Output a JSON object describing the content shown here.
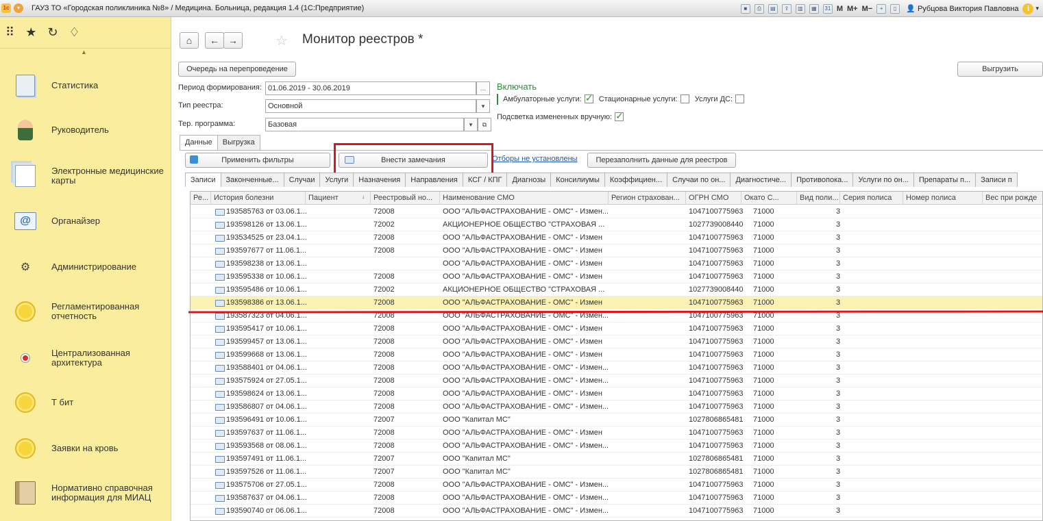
{
  "titlebar": {
    "title": "ГАУЗ ТО «Городская поликлиника №8» / Медицина. Больница, редакция 1.4  (1С:Предприятие)",
    "m_labels": [
      "M",
      "M+",
      "M−"
    ],
    "user": "Рубцова Виктория Павловна"
  },
  "sidebar": {
    "items": [
      {
        "label": "Статистика",
        "icon": "statistics-doc-icon"
      },
      {
        "label": "Руководитель",
        "icon": "manager-person-icon"
      },
      {
        "label": "Электронные медицинские карты",
        "icon": "medical-cards-icon"
      },
      {
        "label": "Органайзер",
        "icon": "organizer-mail-icon"
      },
      {
        "label": "Администрирование",
        "icon": "gear-icon"
      },
      {
        "label": "Регламентированная отчетность",
        "icon": "yellow-circle-icon"
      },
      {
        "label": "Централизованная архитектура",
        "icon": "red-ball-icon"
      },
      {
        "label": "Т бит",
        "icon": "yellow-circle-icon"
      },
      {
        "label": "Заявки на кровь",
        "icon": "yellow-circle-icon"
      },
      {
        "label": "Нормативно справочная информация для МИАЦ",
        "icon": "reference-book-icon"
      }
    ]
  },
  "page": {
    "title": "Монитор реестров *",
    "requeue_button": "Очередь на перепроведение",
    "export_button": "Выгрузить"
  },
  "form": {
    "period_label": "Период формирования:",
    "period_value": "01.06.2019 - 30.06.2019",
    "type_label": "Тип реестра:",
    "type_value": "Основной",
    "program_label": "Тер. программа:",
    "program_value": "Базовая",
    "include_title": "Включать",
    "ambulatory_label": "Амбулаторные услуги:",
    "ambulatory_checked": true,
    "inpatient_label": "Стационарные услуги:",
    "inpatient_checked": false,
    "ds_label": "Услуги ДС:",
    "ds_checked": false,
    "highlight_label": "Подсветка измененных вручную:",
    "highlight_checked": true
  },
  "tabs": [
    "Данные",
    "Выгрузка"
  ],
  "toolbar": {
    "apply_filters": "Применить фильтры",
    "add_remarks": "Внести замечания",
    "filters_link": "Отборы не установлены",
    "refill": "Перезаполнить данные для реестров"
  },
  "subtabs": [
    "Записи",
    "Законченные...",
    "Случаи",
    "Услуги",
    "Назначения",
    "Направления",
    "КСГ / КПГ",
    "Диагнозы",
    "Консилиумы",
    "Коэффициен...",
    "Случаи по он...",
    "Диагностиче...",
    "Противопока...",
    "Услуги по он...",
    "Препараты п...",
    "Записи п"
  ],
  "table": {
    "columns": [
      "Ре...",
      "История болезни",
      "Пациент",
      "Реестровый но...",
      "Наименование СМО",
      "Регион страхован...",
      "ОГРН СМО",
      "Окато С...",
      "Вид поли...",
      "Серия полиса",
      "Номер полиса",
      "Вес при рожде"
    ],
    "rows": [
      [
        "193585763 от 03.06.1...",
        "72008",
        "ООО \"АЛЬФАСТРАХОВАНИЕ - ОМС\" - Измен...",
        "1047100775963",
        "71000",
        "3"
      ],
      [
        "193598126 от 13.06.1...",
        "72002",
        "АКЦИОНЕРНОЕ ОБЩЕСТВО \"СТРАХОВАЯ ...",
        "1027739008440",
        "71000",
        "3"
      ],
      [
        "193534525 от 23.04.1...",
        "72008",
        "ООО \"АЛЬФАСТРАХОВАНИЕ - ОМС\" - Измен",
        "1047100775963",
        "71000",
        "3"
      ],
      [
        "193597677 от 11.06.1...",
        "72008",
        "ООО \"АЛЬФАСТРАХОВАНИЕ - ОМС\" - Измен",
        "1047100775963",
        "71000",
        "3"
      ],
      [
        "193598238 от 13.06.1...",
        "",
        "ООО \"АЛЬФАСТРАХОВАНИЕ - ОМС\" - Измен",
        "1047100775963",
        "71000",
        "3"
      ],
      [
        "193595338 от 10.06.1...",
        "72008",
        "ООО \"АЛЬФАСТРАХОВАНИЕ - ОМС\" - Измен",
        "1047100775963",
        "71000",
        "3"
      ],
      [
        "193595486 от 10.06.1...",
        "72002",
        "АКЦИОНЕРНОЕ ОБЩЕСТВО \"СТРАХОВАЯ ...",
        "1027739008440",
        "71000",
        "3"
      ],
      [
        "193598386 от 13.06.1...",
        "72008",
        "ООО \"АЛЬФАСТРАХОВАНИЕ - ОМС\" - Измен",
        "1047100775963",
        "71000",
        "3"
      ],
      [
        "193587323 от 04.06.1...",
        "72008",
        "ООО \"АЛЬФАСТРАХОВАНИЕ - ОМС\" - Измен...",
        "1047100775963",
        "71000",
        "3"
      ],
      [
        "193595417 от 10.06.1...",
        "72008",
        "ООО \"АЛЬФАСТРАХОВАНИЕ - ОМС\" - Измен",
        "1047100775963",
        "71000",
        "3"
      ],
      [
        "193599457 от 13.06.1...",
        "72008",
        "ООО \"АЛЬФАСТРАХОВАНИЕ - ОМС\" - Измен",
        "1047100775963",
        "71000",
        "3"
      ],
      [
        "193599668 от 13.06.1...",
        "72008",
        "ООО \"АЛЬФАСТРАХОВАНИЕ - ОМС\" - Измен",
        "1047100775963",
        "71000",
        "3"
      ],
      [
        "193588401 от 04.06.1...",
        "72008",
        "ООО \"АЛЬФАСТРАХОВАНИЕ - ОМС\" - Измен...",
        "1047100775963",
        "71000",
        "3"
      ],
      [
        "193575924 от 27.05.1...",
        "72008",
        "ООО \"АЛЬФАСТРАХОВАНИЕ - ОМС\" - Измен...",
        "1047100775963",
        "71000",
        "3"
      ],
      [
        "193598624 от 13.06.1...",
        "72008",
        "ООО \"АЛЬФАСТРАХОВАНИЕ - ОМС\" - Измен",
        "1047100775963",
        "71000",
        "3"
      ],
      [
        "193586807 от 04.06.1...",
        "72008",
        "ООО \"АЛЬФАСТРАХОВАНИЕ - ОМС\" - Измен...",
        "1047100775963",
        "71000",
        "3"
      ],
      [
        "193596491 от 10.06.1...",
        "72007",
        "ООО \"Капитал МС\"",
        "1027806865481",
        "71000",
        "3"
      ],
      [
        "193597637 от 11.06.1...",
        "72008",
        "ООО \"АЛЬФАСТРАХОВАНИЕ - ОМС\" - Измен",
        "1047100775963",
        "71000",
        "3"
      ],
      [
        "193593568 от 08.06.1...",
        "72008",
        "ООО \"АЛЬФАСТРАХОВАНИЕ - ОМС\" - Измен...",
        "1047100775963",
        "71000",
        "3"
      ],
      [
        "193597491 от 11.06.1...",
        "72007",
        "ООО \"Капитал МС\"",
        "1027806865481",
        "71000",
        "3"
      ],
      [
        "193597526 от 11.06.1...",
        "72007",
        "ООО \"Капитал МС\"",
        "1027806865481",
        "71000",
        "3"
      ],
      [
        "193575706 от 27.05.1...",
        "72008",
        "ООО \"АЛЬФАСТРАХОВАНИЕ - ОМС\" - Измен...",
        "1047100775963",
        "71000",
        "3"
      ],
      [
        "193587637 от 04.06.1...",
        "72008",
        "ООО \"АЛЬФАСТРАХОВАНИЕ - ОМС\" - Измен...",
        "1047100775963",
        "71000",
        "3"
      ],
      [
        "193590740 от 06.06.1...",
        "72008",
        "ООО \"АЛЬФАСТРАХОВАНИЕ - ОМС\" - Измен...",
        "1047100775963",
        "71000",
        "3"
      ]
    ],
    "selected_row": 7
  },
  "colors": {
    "sidebar_bg": "#fbed9e",
    "selected_row": "#fbf1b2",
    "annotation_red": "#e0141d",
    "group_green": "#2f8a3c"
  }
}
